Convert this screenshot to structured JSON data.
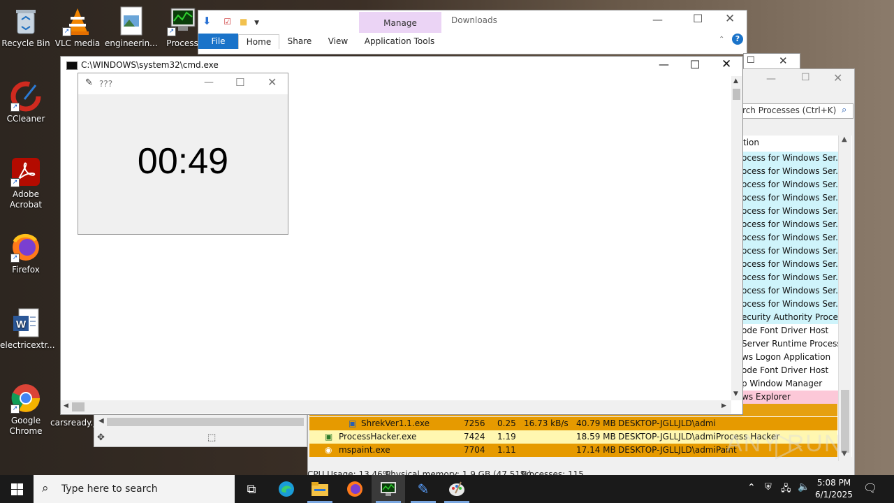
{
  "desktop": {
    "icons": [
      {
        "label": "Recycle Bin"
      },
      {
        "label": "VLC media"
      },
      {
        "label": "engineerin..."
      },
      {
        "label": "Process"
      },
      {
        "label": "CCleaner"
      },
      {
        "label": "Adobe Acrobat"
      },
      {
        "label": "Firefox"
      },
      {
        "label": "electricextr..."
      },
      {
        "label": "Google Chrome"
      },
      {
        "label": "carsready.j"
      }
    ]
  },
  "explorer": {
    "title": "Downloads",
    "manage_label": "Manage",
    "tabs": [
      "File",
      "Home",
      "Share",
      "View",
      "Application Tools"
    ]
  },
  "process_hacker": {
    "search_placeholder": "rch Processes (Ctrl+K)",
    "column_header": "tion",
    "descriptions": [
      "ocess for Windows Ser...",
      "ocess for Windows Ser...",
      "ocess for Windows Ser...",
      "ocess for Windows Ser...",
      "ocess for Windows Ser...",
      "ocess for Windows Ser...",
      "ocess for Windows Ser...",
      "ocess for Windows Ser...",
      "ocess for Windows Ser...",
      "ocess for Windows Ser...",
      "ocess for Windows Ser...",
      "ocess for Windows Ser...",
      "ecurity Authority Proce...",
      "ode Font Driver Host",
      "Server Runtime Process",
      "ws Logon Application",
      "ode Font Driver Host",
      "p Window Manager",
      "ws Explorer"
    ],
    "rows": [
      {
        "name": "ShrekVer1.1.exe",
        "pid": "7256",
        "cpu": "0.25",
        "io": "16.73 kB/s",
        "mem": "40.79 MB",
        "user": "DESKTOP-JGLLJLD\\admi",
        "desc": ""
      },
      {
        "name": "ProcessHacker.exe",
        "pid": "7424",
        "cpu": "1.19",
        "io": "",
        "mem": "18.59 MB",
        "user": "DESKTOP-JGLLJLD\\admi",
        "desc": "Process Hacker"
      },
      {
        "name": "mspaint.exe",
        "pid": "7704",
        "cpu": "1.11",
        "io": "",
        "mem": "17.14 MB",
        "user": "DESKTOP-JGLLJLD\\admi",
        "desc": "Paint"
      }
    ],
    "status": {
      "cpu": "CPU Usage: 13.46%",
      "memory": "Physical memory: 1.9 GB (47.51%)",
      "processes": "Processes: 115"
    }
  },
  "cmd": {
    "title": "C:\\WINDOWS\\system32\\cmd.exe"
  },
  "timer": {
    "title": "???",
    "time": "00:49"
  },
  "taskbar": {
    "search_placeholder": "Type here to search",
    "time": "5:08 PM",
    "date": "6/1/2025"
  },
  "watermark": "ANY RUN"
}
